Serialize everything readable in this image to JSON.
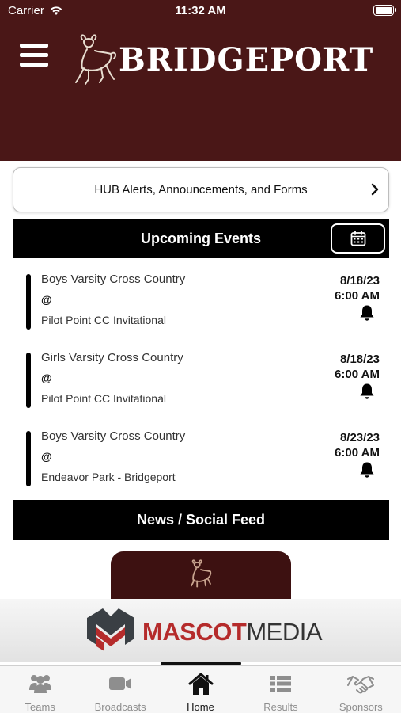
{
  "status_bar": {
    "carrier": "Carrier",
    "time": "11:32 AM"
  },
  "header": {
    "title": "BRIDGEPORT",
    "background": "#4a1717"
  },
  "hub": {
    "label": "HUB Alerts, Announcements, and Forms"
  },
  "upcoming": {
    "title": "Upcoming Events",
    "events": [
      {
        "name": "Boys Varsity Cross Country",
        "at": "@",
        "location": "Pilot Point CC Invitational",
        "date": "8/18/23",
        "time": "6:00 AM"
      },
      {
        "name": "Girls Varsity Cross Country",
        "at": "@",
        "location": "Pilot Point CC Invitational",
        "date": "8/18/23",
        "time": "6:00 AM"
      },
      {
        "name": "Boys Varsity Cross Country",
        "at": "@",
        "location": "Endeavor Park - Bridgeport",
        "date": "8/23/23",
        "time": "6:00 AM"
      }
    ]
  },
  "news": {
    "title": "News / Social Feed"
  },
  "sponsor": {
    "mascot": "MASCOT",
    "media": "MEDIA",
    "accent": "#b52b2b"
  },
  "tabs": [
    {
      "label": "Teams",
      "icon": "users-icon"
    },
    {
      "label": "Broadcasts",
      "icon": "video-camera-icon"
    },
    {
      "label": "Home",
      "icon": "home-icon",
      "active": true
    },
    {
      "label": "Results",
      "icon": "list-icon"
    },
    {
      "label": "Sponsors",
      "icon": "handshake-icon"
    }
  ]
}
